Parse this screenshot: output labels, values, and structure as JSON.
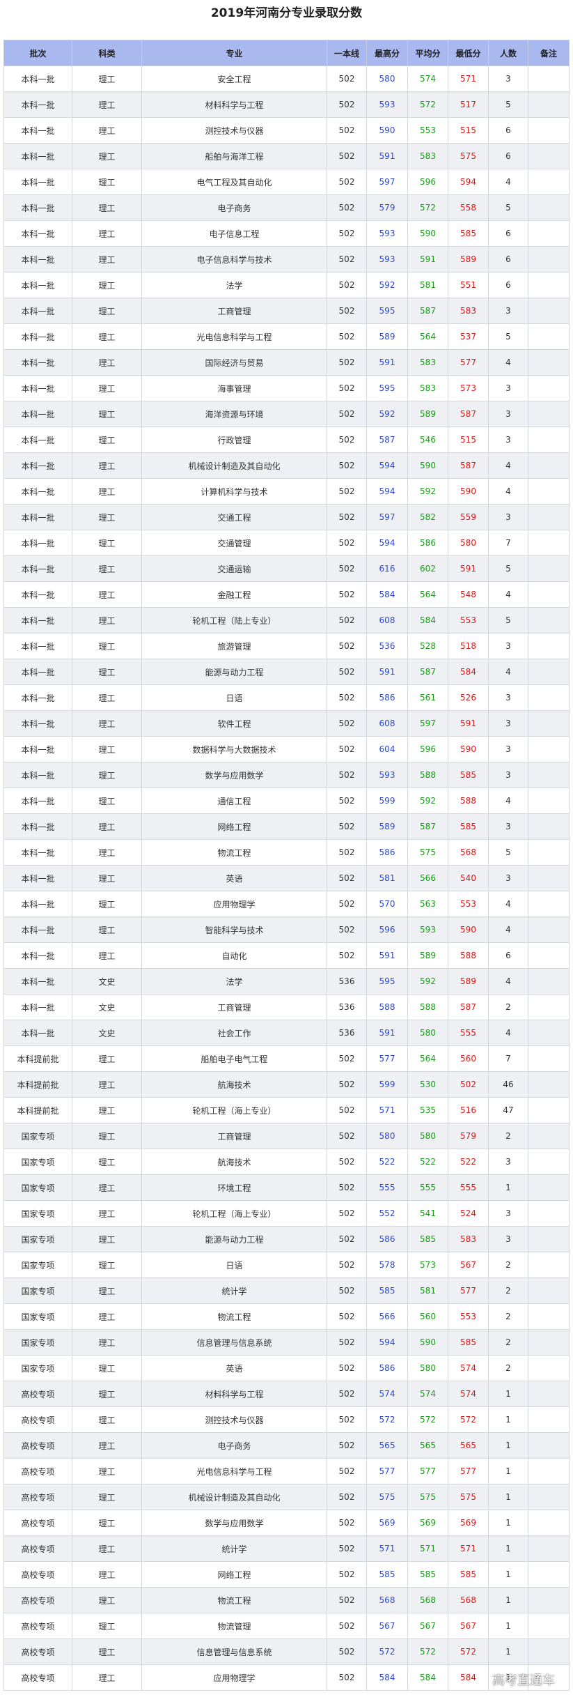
{
  "title": "2019年河南分专业录取分数",
  "watermark": "高考直通车",
  "headers": [
    "批次",
    "科类",
    "专业",
    "一本线",
    "最高分",
    "平均分",
    "最低分",
    "人数",
    "备注"
  ],
  "rows": [
    [
      "本科一批",
      "理工",
      "安全工程",
      "502",
      "580",
      "574",
      "571",
      "3",
      ""
    ],
    [
      "本科一批",
      "理工",
      "材料科学与工程",
      "502",
      "593",
      "572",
      "517",
      "5",
      ""
    ],
    [
      "本科一批",
      "理工",
      "测控技术与仪器",
      "502",
      "590",
      "553",
      "515",
      "6",
      ""
    ],
    [
      "本科一批",
      "理工",
      "船舶与海洋工程",
      "502",
      "591",
      "583",
      "575",
      "6",
      ""
    ],
    [
      "本科一批",
      "理工",
      "电气工程及其自动化",
      "502",
      "597",
      "596",
      "594",
      "4",
      ""
    ],
    [
      "本科一批",
      "理工",
      "电子商务",
      "502",
      "579",
      "572",
      "558",
      "5",
      ""
    ],
    [
      "本科一批",
      "理工",
      "电子信息工程",
      "502",
      "593",
      "590",
      "585",
      "6",
      ""
    ],
    [
      "本科一批",
      "理工",
      "电子信息科学与技术",
      "502",
      "593",
      "591",
      "589",
      "6",
      ""
    ],
    [
      "本科一批",
      "理工",
      "法学",
      "502",
      "592",
      "581",
      "551",
      "6",
      ""
    ],
    [
      "本科一批",
      "理工",
      "工商管理",
      "502",
      "595",
      "587",
      "583",
      "3",
      ""
    ],
    [
      "本科一批",
      "理工",
      "光电信息科学与工程",
      "502",
      "589",
      "564",
      "537",
      "5",
      ""
    ],
    [
      "本科一批",
      "理工",
      "国际经济与贸易",
      "502",
      "591",
      "583",
      "577",
      "4",
      ""
    ],
    [
      "本科一批",
      "理工",
      "海事管理",
      "502",
      "595",
      "583",
      "573",
      "3",
      ""
    ],
    [
      "本科一批",
      "理工",
      "海洋资源与环境",
      "502",
      "592",
      "589",
      "587",
      "3",
      ""
    ],
    [
      "本科一批",
      "理工",
      "行政管理",
      "502",
      "587",
      "546",
      "515",
      "3",
      ""
    ],
    [
      "本科一批",
      "理工",
      "机械设计制造及其自动化",
      "502",
      "594",
      "590",
      "587",
      "4",
      ""
    ],
    [
      "本科一批",
      "理工",
      "计算机科学与技术",
      "502",
      "594",
      "592",
      "590",
      "4",
      ""
    ],
    [
      "本科一批",
      "理工",
      "交通工程",
      "502",
      "597",
      "582",
      "559",
      "3",
      ""
    ],
    [
      "本科一批",
      "理工",
      "交通管理",
      "502",
      "594",
      "586",
      "580",
      "7",
      ""
    ],
    [
      "本科一批",
      "理工",
      "交通运输",
      "502",
      "616",
      "602",
      "591",
      "5",
      ""
    ],
    [
      "本科一批",
      "理工",
      "金融工程",
      "502",
      "584",
      "564",
      "548",
      "4",
      ""
    ],
    [
      "本科一批",
      "理工",
      "轮机工程（陆上专业）",
      "502",
      "608",
      "584",
      "553",
      "5",
      ""
    ],
    [
      "本科一批",
      "理工",
      "旅游管理",
      "502",
      "536",
      "528",
      "518",
      "3",
      ""
    ],
    [
      "本科一批",
      "理工",
      "能源与动力工程",
      "502",
      "591",
      "587",
      "584",
      "4",
      ""
    ],
    [
      "本科一批",
      "理工",
      "日语",
      "502",
      "586",
      "561",
      "526",
      "3",
      ""
    ],
    [
      "本科一批",
      "理工",
      "软件工程",
      "502",
      "608",
      "597",
      "591",
      "3",
      ""
    ],
    [
      "本科一批",
      "理工",
      "数据科学与大数据技术",
      "502",
      "604",
      "596",
      "590",
      "3",
      ""
    ],
    [
      "本科一批",
      "理工",
      "数学与应用数学",
      "502",
      "593",
      "588",
      "585",
      "3",
      ""
    ],
    [
      "本科一批",
      "理工",
      "通信工程",
      "502",
      "599",
      "592",
      "588",
      "4",
      ""
    ],
    [
      "本科一批",
      "理工",
      "网络工程",
      "502",
      "589",
      "587",
      "585",
      "3",
      ""
    ],
    [
      "本科一批",
      "理工",
      "物流工程",
      "502",
      "586",
      "575",
      "568",
      "5",
      ""
    ],
    [
      "本科一批",
      "理工",
      "英语",
      "502",
      "581",
      "566",
      "540",
      "3",
      ""
    ],
    [
      "本科一批",
      "理工",
      "应用物理学",
      "502",
      "570",
      "563",
      "553",
      "4",
      ""
    ],
    [
      "本科一批",
      "理工",
      "智能科学与技术",
      "502",
      "596",
      "593",
      "590",
      "4",
      ""
    ],
    [
      "本科一批",
      "理工",
      "自动化",
      "502",
      "591",
      "589",
      "588",
      "6",
      ""
    ],
    [
      "本科一批",
      "文史",
      "法学",
      "536",
      "595",
      "592",
      "589",
      "4",
      ""
    ],
    [
      "本科一批",
      "文史",
      "工商管理",
      "536",
      "588",
      "588",
      "587",
      "2",
      ""
    ],
    [
      "本科一批",
      "文史",
      "社会工作",
      "536",
      "591",
      "580",
      "555",
      "4",
      ""
    ],
    [
      "本科提前批",
      "理工",
      "船舶电子电气工程",
      "502",
      "577",
      "564",
      "560",
      "7",
      ""
    ],
    [
      "本科提前批",
      "理工",
      "航海技术",
      "502",
      "599",
      "530",
      "502",
      "46",
      ""
    ],
    [
      "本科提前批",
      "理工",
      "轮机工程（海上专业）",
      "502",
      "571",
      "535",
      "516",
      "47",
      ""
    ],
    [
      "国家专项",
      "理工",
      "工商管理",
      "502",
      "580",
      "580",
      "579",
      "2",
      ""
    ],
    [
      "国家专项",
      "理工",
      "航海技术",
      "502",
      "522",
      "522",
      "522",
      "3",
      ""
    ],
    [
      "国家专项",
      "理工",
      "环境工程",
      "502",
      "555",
      "555",
      "555",
      "1",
      ""
    ],
    [
      "国家专项",
      "理工",
      "轮机工程（海上专业）",
      "502",
      "552",
      "541",
      "524",
      "3",
      ""
    ],
    [
      "国家专项",
      "理工",
      "能源与动力工程",
      "502",
      "586",
      "585",
      "583",
      "3",
      ""
    ],
    [
      "国家专项",
      "理工",
      "日语",
      "502",
      "578",
      "573",
      "567",
      "2",
      ""
    ],
    [
      "国家专项",
      "理工",
      "统计学",
      "502",
      "585",
      "581",
      "577",
      "2",
      ""
    ],
    [
      "国家专项",
      "理工",
      "物流工程",
      "502",
      "566",
      "560",
      "553",
      "2",
      ""
    ],
    [
      "国家专项",
      "理工",
      "信息管理与信息系统",
      "502",
      "594",
      "590",
      "585",
      "2",
      ""
    ],
    [
      "国家专项",
      "理工",
      "英语",
      "502",
      "586",
      "580",
      "574",
      "2",
      ""
    ],
    [
      "高校专项",
      "理工",
      "材料科学与工程",
      "502",
      "574",
      "574",
      "574",
      "1",
      ""
    ],
    [
      "高校专项",
      "理工",
      "测控技术与仪器",
      "502",
      "572",
      "572",
      "572",
      "1",
      ""
    ],
    [
      "高校专项",
      "理工",
      "电子商务",
      "502",
      "565",
      "565",
      "565",
      "1",
      ""
    ],
    [
      "高校专项",
      "理工",
      "光电信息科学与工程",
      "502",
      "577",
      "577",
      "577",
      "1",
      ""
    ],
    [
      "高校专项",
      "理工",
      "机械设计制造及其自动化",
      "502",
      "575",
      "575",
      "575",
      "1",
      ""
    ],
    [
      "高校专项",
      "理工",
      "数学与应用数学",
      "502",
      "569",
      "569",
      "569",
      "1",
      ""
    ],
    [
      "高校专项",
      "理工",
      "统计学",
      "502",
      "571",
      "571",
      "571",
      "1",
      ""
    ],
    [
      "高校专项",
      "理工",
      "网络工程",
      "502",
      "585",
      "585",
      "585",
      "1",
      ""
    ],
    [
      "高校专项",
      "理工",
      "物流工程",
      "502",
      "568",
      "568",
      "568",
      "1",
      ""
    ],
    [
      "高校专项",
      "理工",
      "物流管理",
      "502",
      "567",
      "567",
      "567",
      "1",
      ""
    ],
    [
      "高校专项",
      "理工",
      "信息管理与信息系统",
      "502",
      "572",
      "572",
      "572",
      "1",
      ""
    ],
    [
      "高校专项",
      "理工",
      "应用物理学",
      "502",
      "584",
      "584",
      "584",
      "1",
      ""
    ]
  ]
}
